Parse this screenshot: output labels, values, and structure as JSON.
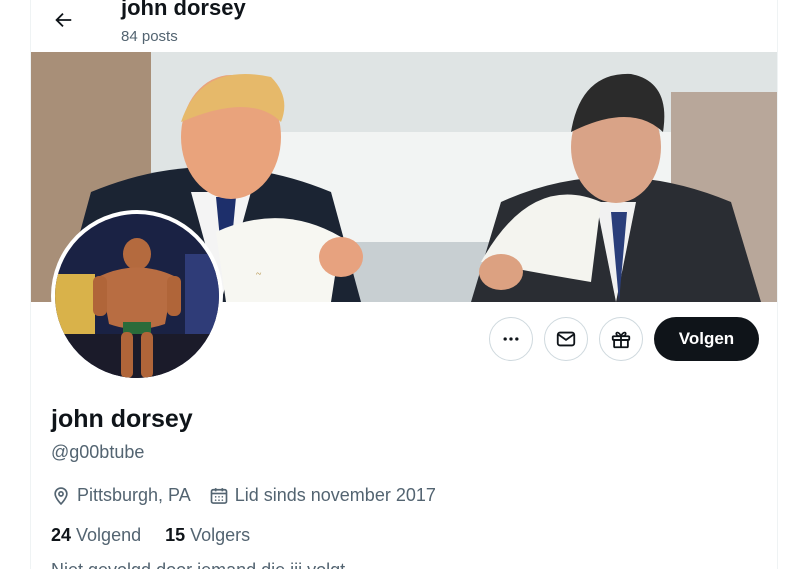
{
  "header": {
    "back_icon": "arrow-left-icon",
    "name": "john dorsey",
    "post_count": "84 posts"
  },
  "banner": {
    "description_icon": "banner-photo"
  },
  "avatar": {
    "description_icon": "avatar-photo"
  },
  "actions": {
    "more_icon": "ellipsis-icon",
    "message_icon": "mail-icon",
    "gift_icon": "gift-icon",
    "follow_label": "Volgen"
  },
  "profile": {
    "name": "john dorsey",
    "handle": "@g00btube",
    "location": "Pittsburgh, PA",
    "joined": "Lid sinds november 2017",
    "following_count": "24",
    "following_label": "Volgend",
    "followers_count": "15",
    "followers_label": "Volgers",
    "partial_line": "Niet gevolgd door iemand die jij volgt"
  },
  "colors": {
    "text": "#0f1419",
    "secondary": "#536471",
    "border": "#cfd9de"
  }
}
